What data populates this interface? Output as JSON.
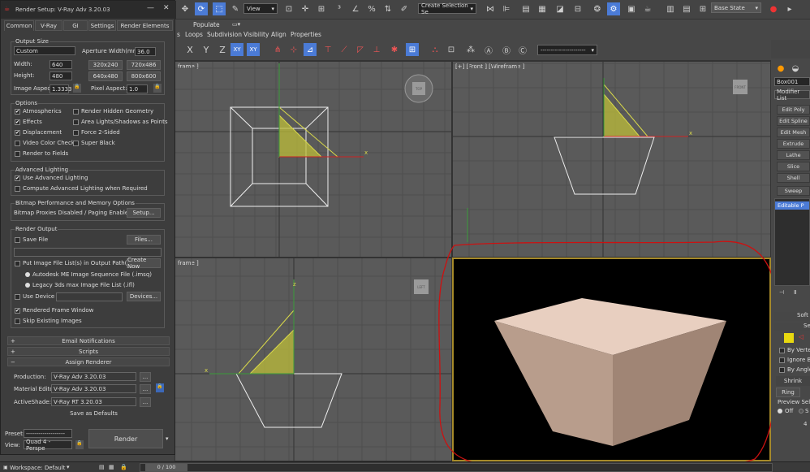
{
  "toolbar": {
    "view_dropdown": "View",
    "selection_set_placeholder": "Create Selection Se",
    "state_dropdown": "Base State"
  },
  "ribbon": {
    "populate_tab": "Populate",
    "tabs": [
      "s",
      "Loops",
      "Subdivision",
      "Visibility",
      "Align",
      "Properties"
    ],
    "axes": [
      "X",
      "Y",
      "Z",
      "XY",
      "XY"
    ],
    "set_dropdown": "----------------------"
  },
  "viewports": {
    "top": {
      "label": "frame ]"
    },
    "front": {
      "label": "[+] [Front ] [Wireframe ]"
    },
    "left": {
      "label": "frame ]"
    },
    "cube_top": "TOP",
    "cube_front": "FRONT",
    "cube_left": "LEFT",
    "axis_x": "x",
    "axis_z": "z"
  },
  "command_panel": {
    "object_name": "Box001",
    "modifier_list": "Modifier List",
    "modifiers": [
      "Edit Poly",
      "Edit Spline",
      "Edit Mesh",
      "Extrude",
      "Lathe",
      "Slice",
      "Shell",
      "Sweep"
    ],
    "stack_item": "Editable P",
    "soft_label": "Soft",
    "sel_label": "Se",
    "options": [
      "By Verte",
      "Ignore Ba",
      "By Angle"
    ],
    "shrink": "Shrink",
    "ring": "Ring",
    "preview_label": "Preview Sele",
    "off_label": "Off",
    "s_label": "S",
    "num4": "4"
  },
  "render_setup": {
    "title": "Render Setup: V-Ray Adv 3.20.03",
    "tabs": [
      "Common",
      "V-Ray",
      "GI",
      "Settings",
      "Render Elements"
    ],
    "output_size": {
      "group": "Output Size",
      "preset": "Custom",
      "aperture_label": "Aperture Width(mm):",
      "aperture_value": "36.0",
      "width_label": "Width:",
      "width_value": "640",
      "height_label": "Height:",
      "height_value": "480",
      "presets": [
        "320x240",
        "720x486",
        "640x480",
        "800x600"
      ],
      "image_aspect_label": "Image Aspect:",
      "image_aspect_value": "1.3333",
      "pixel_aspect_label": "Pixel Aspect:",
      "pixel_aspect_value": "1.0"
    },
    "options": {
      "group": "Options",
      "items": [
        {
          "label": "Atmospherics",
          "checked": "✔"
        },
        {
          "label": "Render Hidden Geometry",
          "checked": ""
        },
        {
          "label": "Effects",
          "checked": "✔"
        },
        {
          "label": "Area Lights/Shadows as Points",
          "checked": ""
        },
        {
          "label": "Displacement",
          "checked": "✔"
        },
        {
          "label": "Force 2-Sided",
          "checked": ""
        },
        {
          "label": "Video Color Check",
          "checked": ""
        },
        {
          "label": "Super Black",
          "checked": ""
        },
        {
          "label": "Render to Fields",
          "checked": ""
        }
      ]
    },
    "advanced_lighting": {
      "group": "Advanced Lighting",
      "use": "Use Advanced Lighting",
      "use_checked": "✔",
      "compute": "Compute Advanced Lighting when Required"
    },
    "bitmap": {
      "group": "Bitmap Performance and Memory Options",
      "text": "Bitmap Proxies Disabled / Paging Enabled",
      "setup": "Setup..."
    },
    "render_output": {
      "group": "Render Output",
      "save_file": "Save File",
      "files": "Files...",
      "put_image": "Put Image File List(s) in Output Path(s)",
      "create_now": "Create Now",
      "autodesk": "Autodesk ME Image Sequence File (.imsq)",
      "legacy": "Legacy 3ds max Image File List (.ifl)",
      "use_device": "Use Device",
      "devices": "Devices...",
      "rendered_frame": "Rendered Frame Window",
      "rendered_checked": "✔",
      "skip_existing": "Skip Existing Images"
    },
    "rollouts": [
      "Email Notifications",
      "Scripts",
      "Assign Renderer"
    ],
    "assign": {
      "production_label": "Production:",
      "production_value": "V-Ray Adv 3.20.03",
      "material_label": "Material Editor:",
      "material_value": "V-Ray Adv 3.20.03",
      "activeshade_label": "ActiveShade:",
      "activeshade_value": "V-Ray RT 3.20.03",
      "dots": "...",
      "save_defaults": "Save as Defaults"
    },
    "bottom": {
      "preset_label": "Preset:",
      "preset_value": "-------------------",
      "view_label": "View:",
      "view_value": "Quad 4 - Perspe",
      "render_button": "Render"
    }
  },
  "status": {
    "workspace": "Workspace: Default",
    "frame": "0 / 100"
  },
  "colors": {
    "annotation": "#cc1111",
    "selection": "#4b7bd6",
    "box_light": "#e8cfc0",
    "box_mid": "#b89d8c",
    "box_dark": "#a08575",
    "gizmo_yellow": "#d9d94a"
  }
}
